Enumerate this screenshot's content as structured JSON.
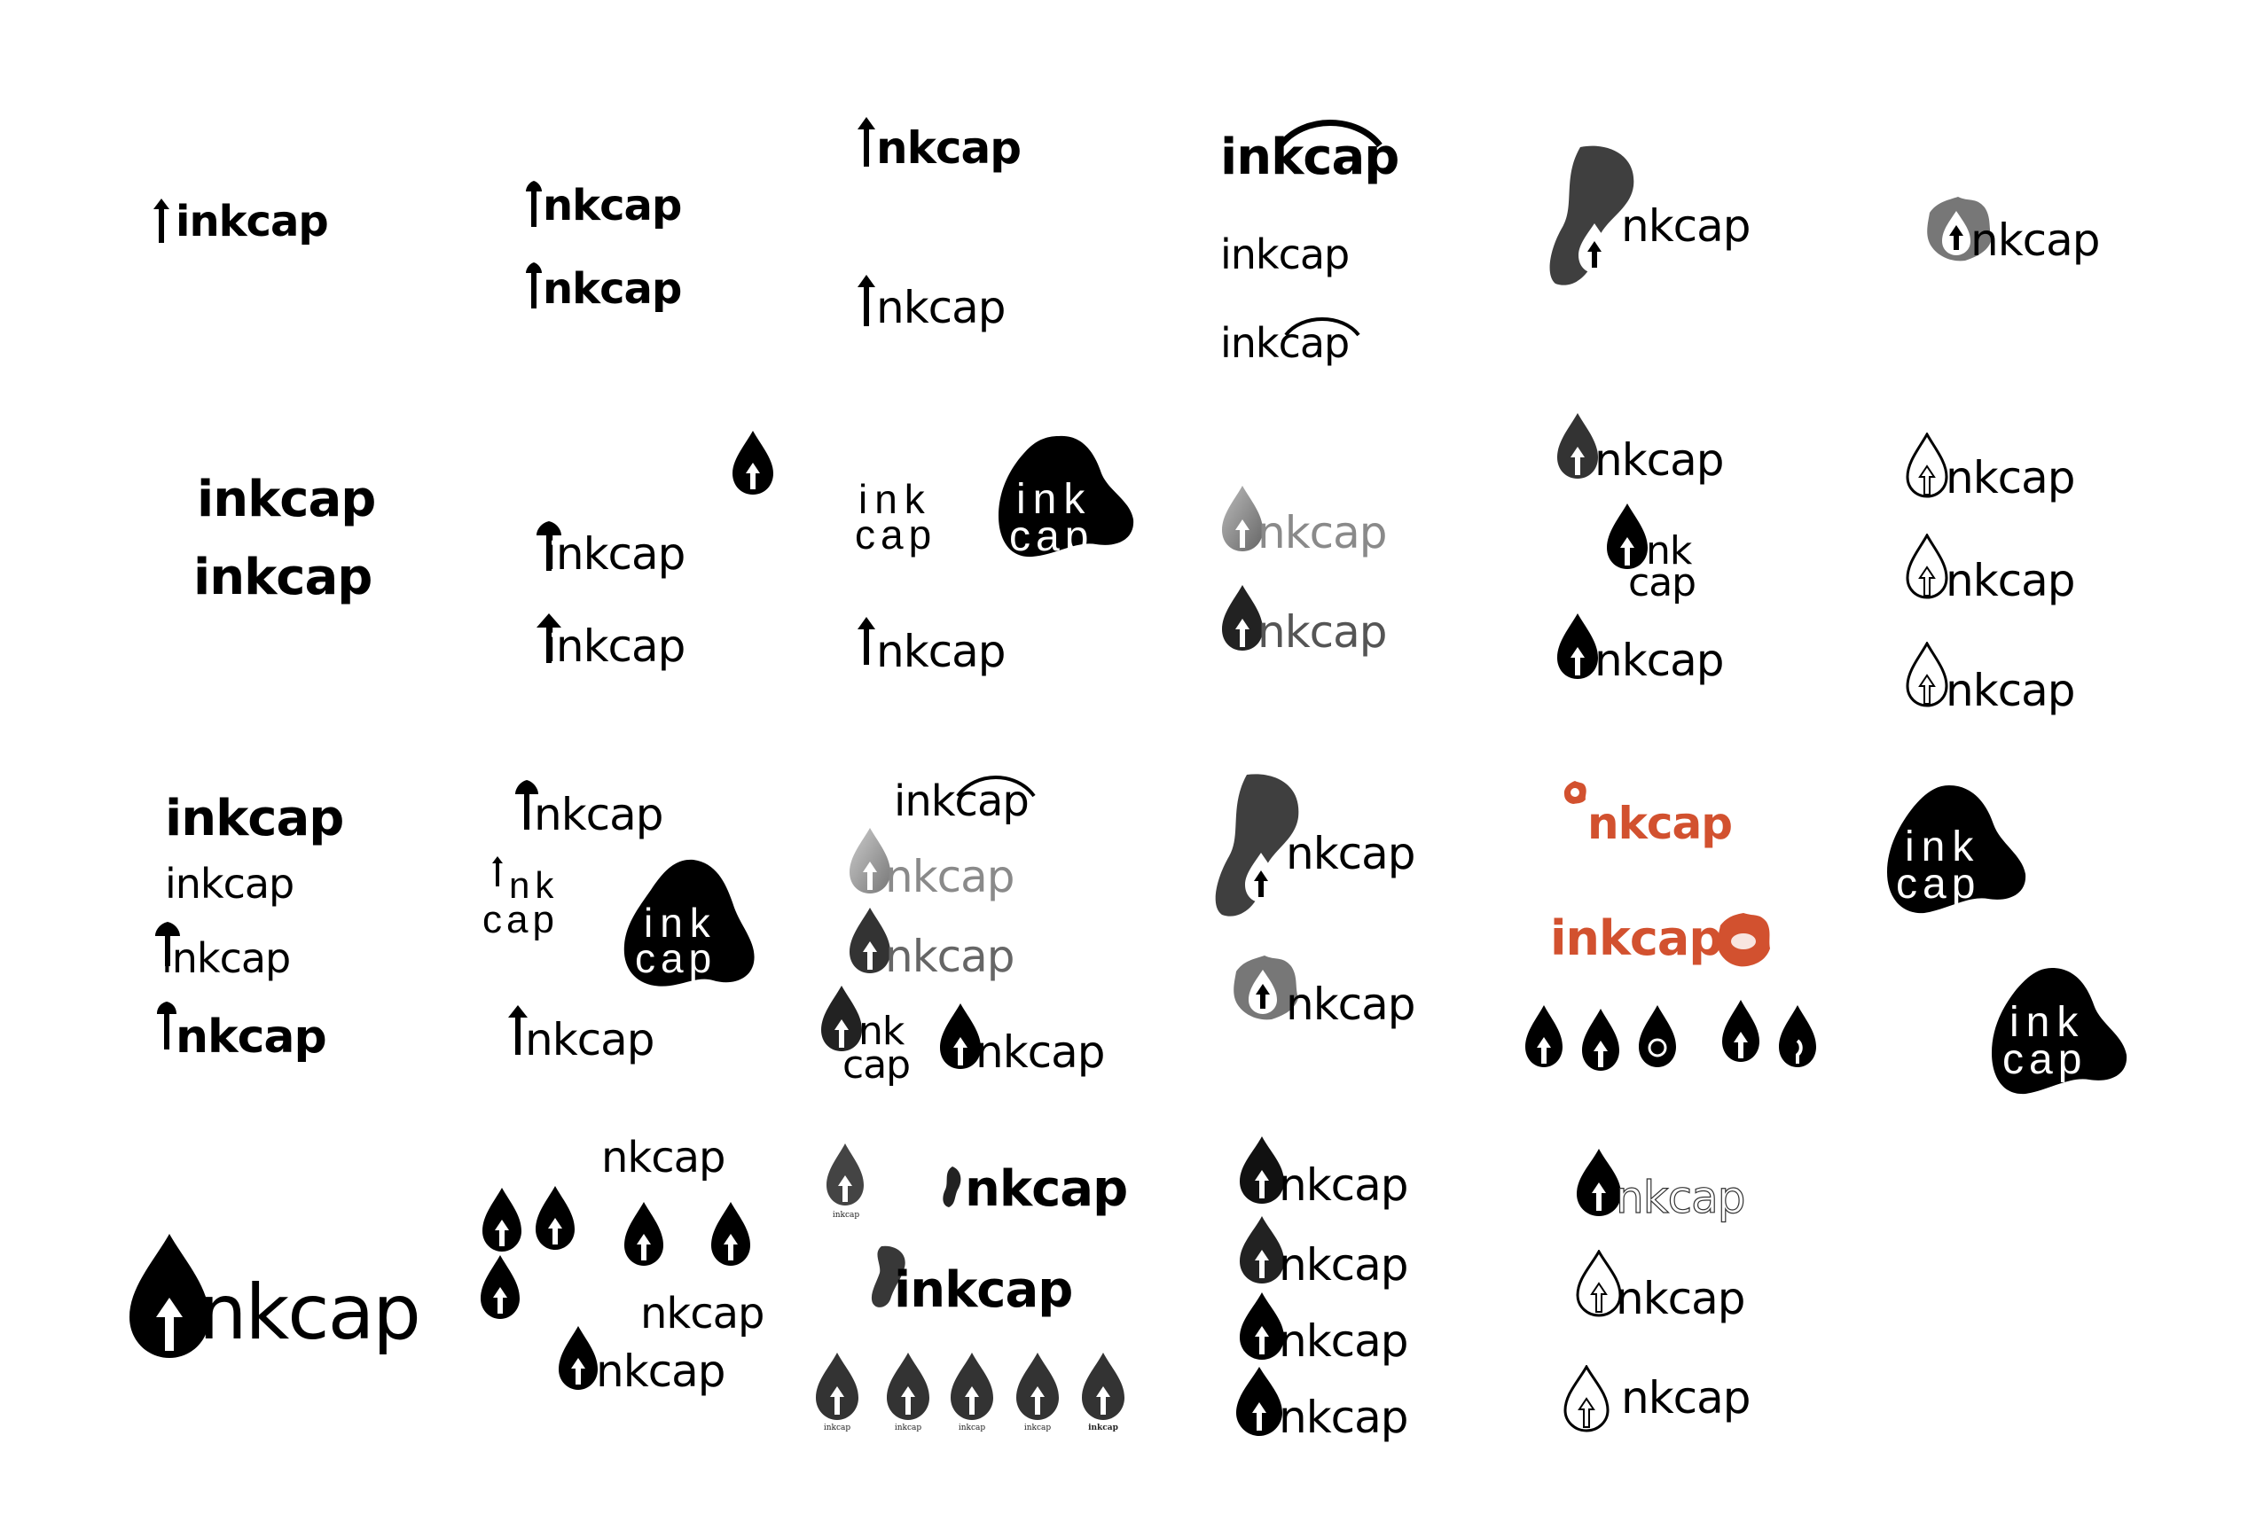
{
  "sheet": {
    "wordmark": "inkcap",
    "suffix": "nkcap",
    "split_top": "ink",
    "split_top_alt": "nk",
    "split_bottom": "cap",
    "accent_color": "#d2512f",
    "mark_color": "#000000",
    "icon_names": [
      "ink-drop-mushroom-icon",
      "mushroom-arrow-icon",
      "blob-icon",
      "ink-splat-icon",
      "ink-brush-stroke-icon"
    ]
  }
}
